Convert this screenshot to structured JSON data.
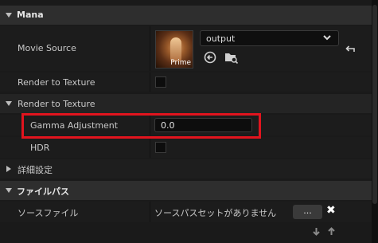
{
  "sections": {
    "mana": {
      "title": "Mana"
    },
    "detail": {
      "title": "詳細設定"
    },
    "filepath": {
      "title": "ファイルパス"
    }
  },
  "movie_source": {
    "label": "Movie Source",
    "thumbnail_caption": "Prime",
    "selected": "output"
  },
  "render_to_texture_prop": {
    "label": "Render to Texture",
    "checked": false
  },
  "render_to_texture_group": {
    "title": "Render to Texture"
  },
  "gamma": {
    "label": "Gamma Adjustment",
    "value": "0.0"
  },
  "hdr": {
    "label": "HDR",
    "checked": false
  },
  "source_file": {
    "label": "ソースファイル",
    "value": "ソースパスセットがありません",
    "browse_label": "..."
  },
  "icons": {
    "reset": "↶",
    "use_selected": "⮈",
    "browse": "folder-search",
    "clear": "✖",
    "move_down": "🡇",
    "move_up": "🡅"
  },
  "colors": {
    "highlight": "#e1141e",
    "background": "#1a1a1a",
    "category": "#2e2e2e"
  }
}
